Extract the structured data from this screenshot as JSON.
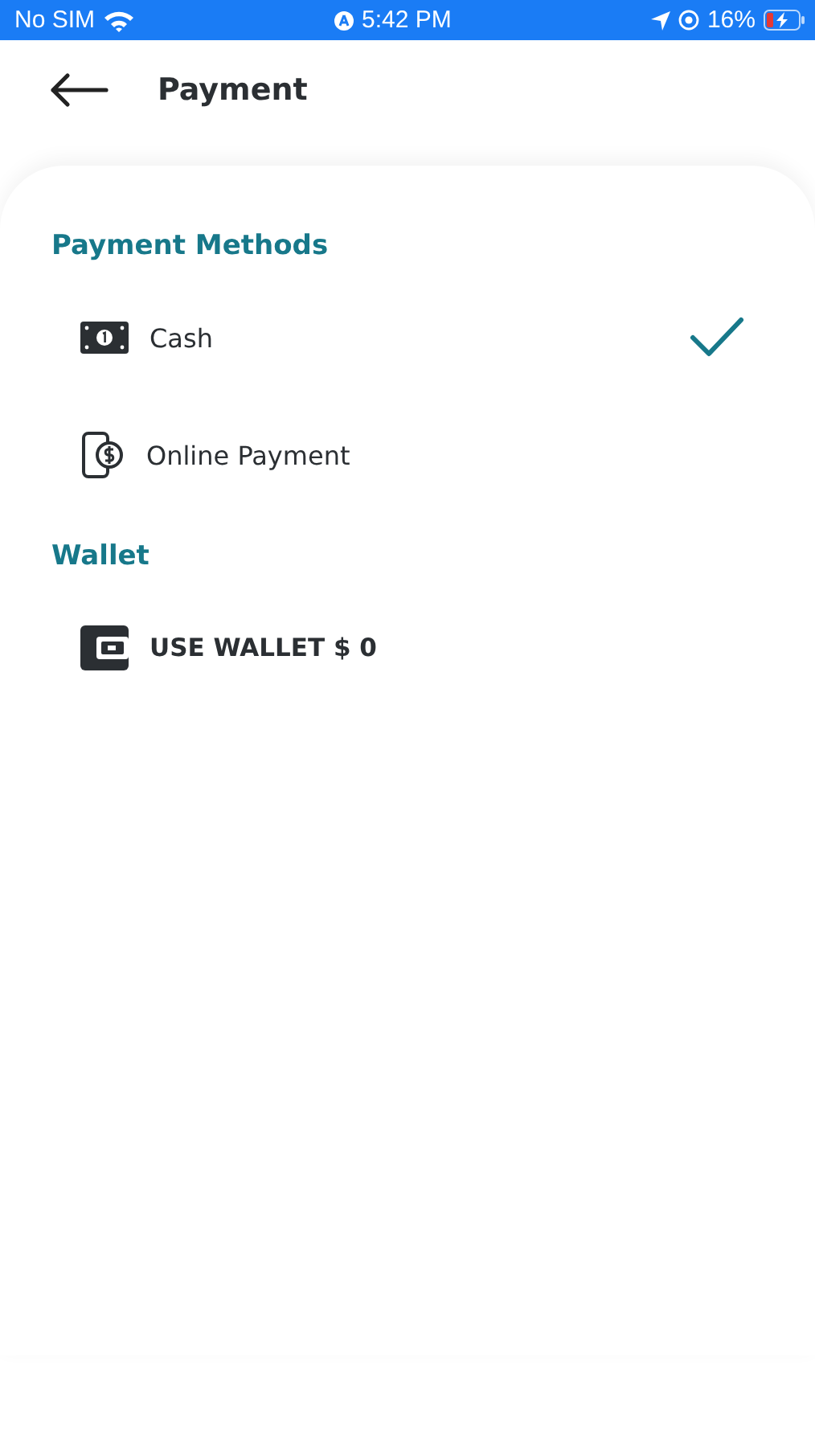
{
  "status_bar": {
    "carrier": "No SIM",
    "time": "5:42 PM",
    "battery": "16%"
  },
  "header": {
    "title": "Payment"
  },
  "sections": [
    {
      "title": "Payment Methods",
      "items": [
        {
          "kind": "cash",
          "label": "Cash",
          "selected": true
        },
        {
          "kind": "online",
          "label": "Online Payment",
          "selected": false
        }
      ]
    },
    {
      "title": "Wallet",
      "items": [
        {
          "kind": "wallet",
          "label": "USE WALLET $ 0"
        }
      ]
    }
  ]
}
